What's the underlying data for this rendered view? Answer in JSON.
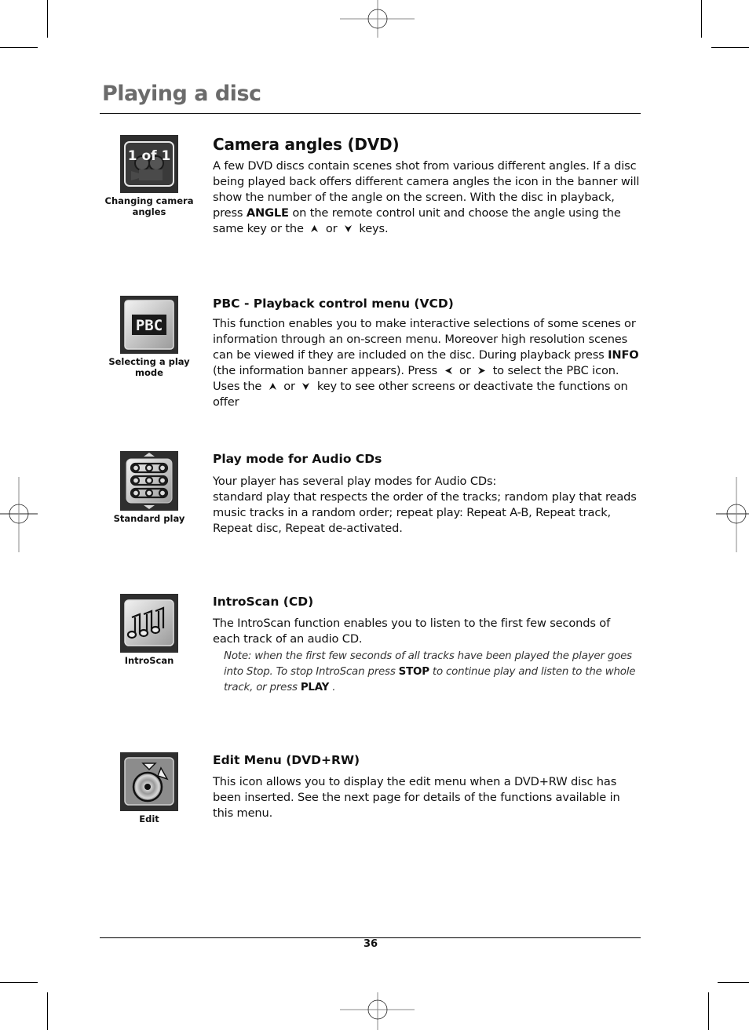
{
  "page": {
    "title": "Playing a disc",
    "page_number": "36"
  },
  "sections": [
    {
      "id": "camera-angles",
      "icon": "camera-angle-icon",
      "icon_text": "1 of 1",
      "caption": "Changing camera angles",
      "heading": "Camera angles (DVD)",
      "body": [
        {
          "t": "A few DVD discs contain scenes shot from various different angles. If a disc being played back offers different camera angles the icon in the banner will show the number of the angle on the screen. With the disc in playback, press "
        },
        {
          "b": "ANGLE"
        },
        {
          "t": " on the remote control unit and choose the angle using the same key or the "
        },
        {
          "arrow": "up"
        },
        {
          "t": " or "
        },
        {
          "arrow": "down"
        },
        {
          "t": " keys."
        }
      ]
    },
    {
      "id": "pbc",
      "icon": "pbc-icon",
      "icon_text": "PBC",
      "caption": "Selecting a play mode",
      "heading": "PBC - Playback control menu (VCD)",
      "body": [
        {
          "t": "This function enables you to make interactive selections of some scenes or information through an on-screen menu. Moreover high resolution scenes can be viewed if they are included on the disc. During playback press "
        },
        {
          "b": "INFO"
        },
        {
          "t": " (the information banner appears). Press "
        },
        {
          "arrow": "left"
        },
        {
          "t": " or "
        },
        {
          "arrow": "right"
        },
        {
          "t": " to select the PBC icon. Uses the "
        },
        {
          "arrow": "up"
        },
        {
          "t": " or "
        },
        {
          "arrow": "down"
        },
        {
          "t": " key to see other screens or deactivate the functions on offer"
        }
      ]
    },
    {
      "id": "play-mode",
      "icon": "standard-play-icon",
      "caption": "Standard play",
      "heading": "Play mode for Audio CDs",
      "body_lines": [
        "Your player has several play modes for Audio CDs:",
        "standard play that respects the order of the tracks; random play that reads music tracks in a random order; repeat play: Repeat A-B, Repeat track, Repeat disc, Repeat de-activated."
      ]
    },
    {
      "id": "introscan",
      "icon": "introscan-music-notes-icon",
      "caption": "IntroScan",
      "heading": "IntroScan (CD)",
      "body": "The IntroScan function enables you to listen to the first few seconds of each track of an audio CD.",
      "note": [
        {
          "t": "Note: when the first few seconds of all tracks have been played the player goes into Stop. To stop IntroScan press "
        },
        {
          "b": "STOP"
        },
        {
          "t": " to continue play and listen to the whole track, or press "
        },
        {
          "b": "PLAY"
        },
        {
          "t": " ."
        }
      ]
    },
    {
      "id": "edit",
      "icon": "edit-disc-icon",
      "caption": "Edit",
      "heading": "Edit Menu (DVD+RW)",
      "body": "This icon allows you to display the edit menu when a DVD+RW disc has been inserted. See the next page for details of the functions available in this menu."
    }
  ]
}
